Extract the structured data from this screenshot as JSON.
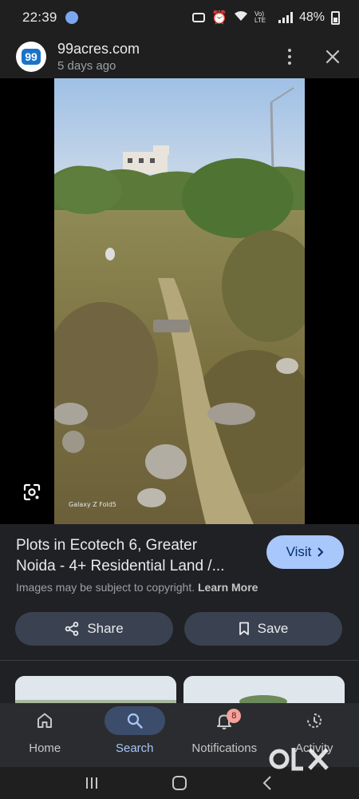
{
  "status_bar": {
    "time": "22:39",
    "network": "Vo) LTE",
    "battery": "48%"
  },
  "header": {
    "favicon_text": "99",
    "site_name": "99acres.com",
    "posted": "5 days ago",
    "more_icon": "more-vert-icon",
    "close_icon": "close-icon"
  },
  "viewer": {
    "photo_watermark": "Galaxy Z Fold5",
    "lens_icon": "google-lens-icon"
  },
  "result": {
    "title_line1": "Plots in Ecotech 6, Greater",
    "title_line2": "Noida - 4+ Residential Land /...",
    "visit_label": "Visit",
    "copyright_text": "Images may be subject to copyright.",
    "learn_more": "Learn More",
    "share_label": "Share",
    "save_label": "Save"
  },
  "bottom_nav": {
    "items": [
      {
        "label": "Home",
        "icon": "home-icon"
      },
      {
        "label": "Search",
        "icon": "search-icon",
        "active": true
      },
      {
        "label": "Notifications",
        "icon": "bell-icon",
        "badge": "8"
      },
      {
        "label": "Activity",
        "icon": "history-icon"
      }
    ]
  },
  "watermark": "OLX",
  "colors": {
    "accent": "#a8c7fa",
    "background": "#1f1f1f",
    "panel": "#202124",
    "pill": "#3a4150"
  }
}
